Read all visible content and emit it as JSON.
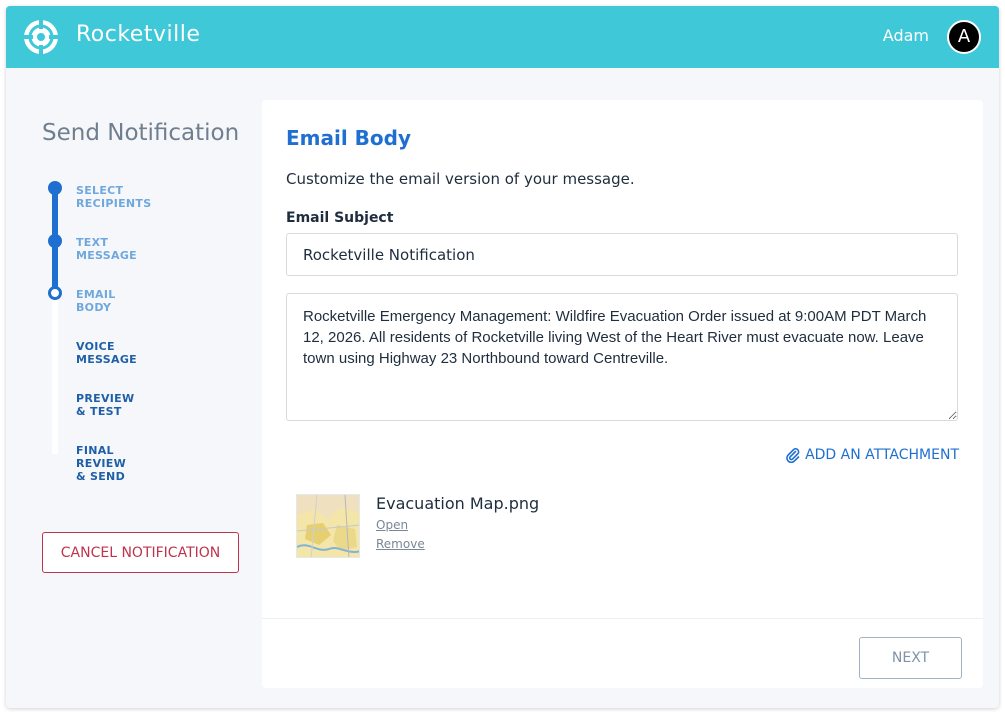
{
  "header": {
    "app_title": "Rocketville",
    "user_name": "Adam",
    "avatar_initial": "A",
    "logo_icon": "crosshair-logo-icon",
    "brand_color": "#3ec8d8"
  },
  "sidebar": {
    "title": "Send Notification",
    "steps": [
      {
        "label": "SELECT RECIPIENTS",
        "state": "done"
      },
      {
        "label": "TEXT MESSAGE",
        "state": "done"
      },
      {
        "label": "EMAIL BODY",
        "state": "current"
      },
      {
        "label": "VOICE MESSAGE",
        "state": "todo"
      },
      {
        "label": "PREVIEW & TEST",
        "state": "todo"
      },
      {
        "label": "FINAL REVIEW & SEND",
        "state": "todo"
      }
    ],
    "cancel_label": "CANCEL NOTIFICATION",
    "accent_color": "#1f6fd0",
    "danger_color": "#c0334d"
  },
  "main": {
    "title": "Email Body",
    "subtitle": "Customize the email version of your message.",
    "subject_label": "Email Subject",
    "subject_value": "Rocketville Notification",
    "body_value": "Rocketville Emergency Management: Wildfire Evacuation Order issued at 9:00AM PDT March 12, 2026. All residents of Rocketville living West of the Heart River must evacuate now. Leave town using Highway 23 Northbound toward Centreville.",
    "attach_label": "ADD AN ATTACHMENT",
    "attach_icon": "paperclip-icon",
    "attachment": {
      "name": "Evacuation Map.png",
      "open_label": "Open",
      "remove_label": "Remove"
    },
    "next_label": "NEXT"
  }
}
